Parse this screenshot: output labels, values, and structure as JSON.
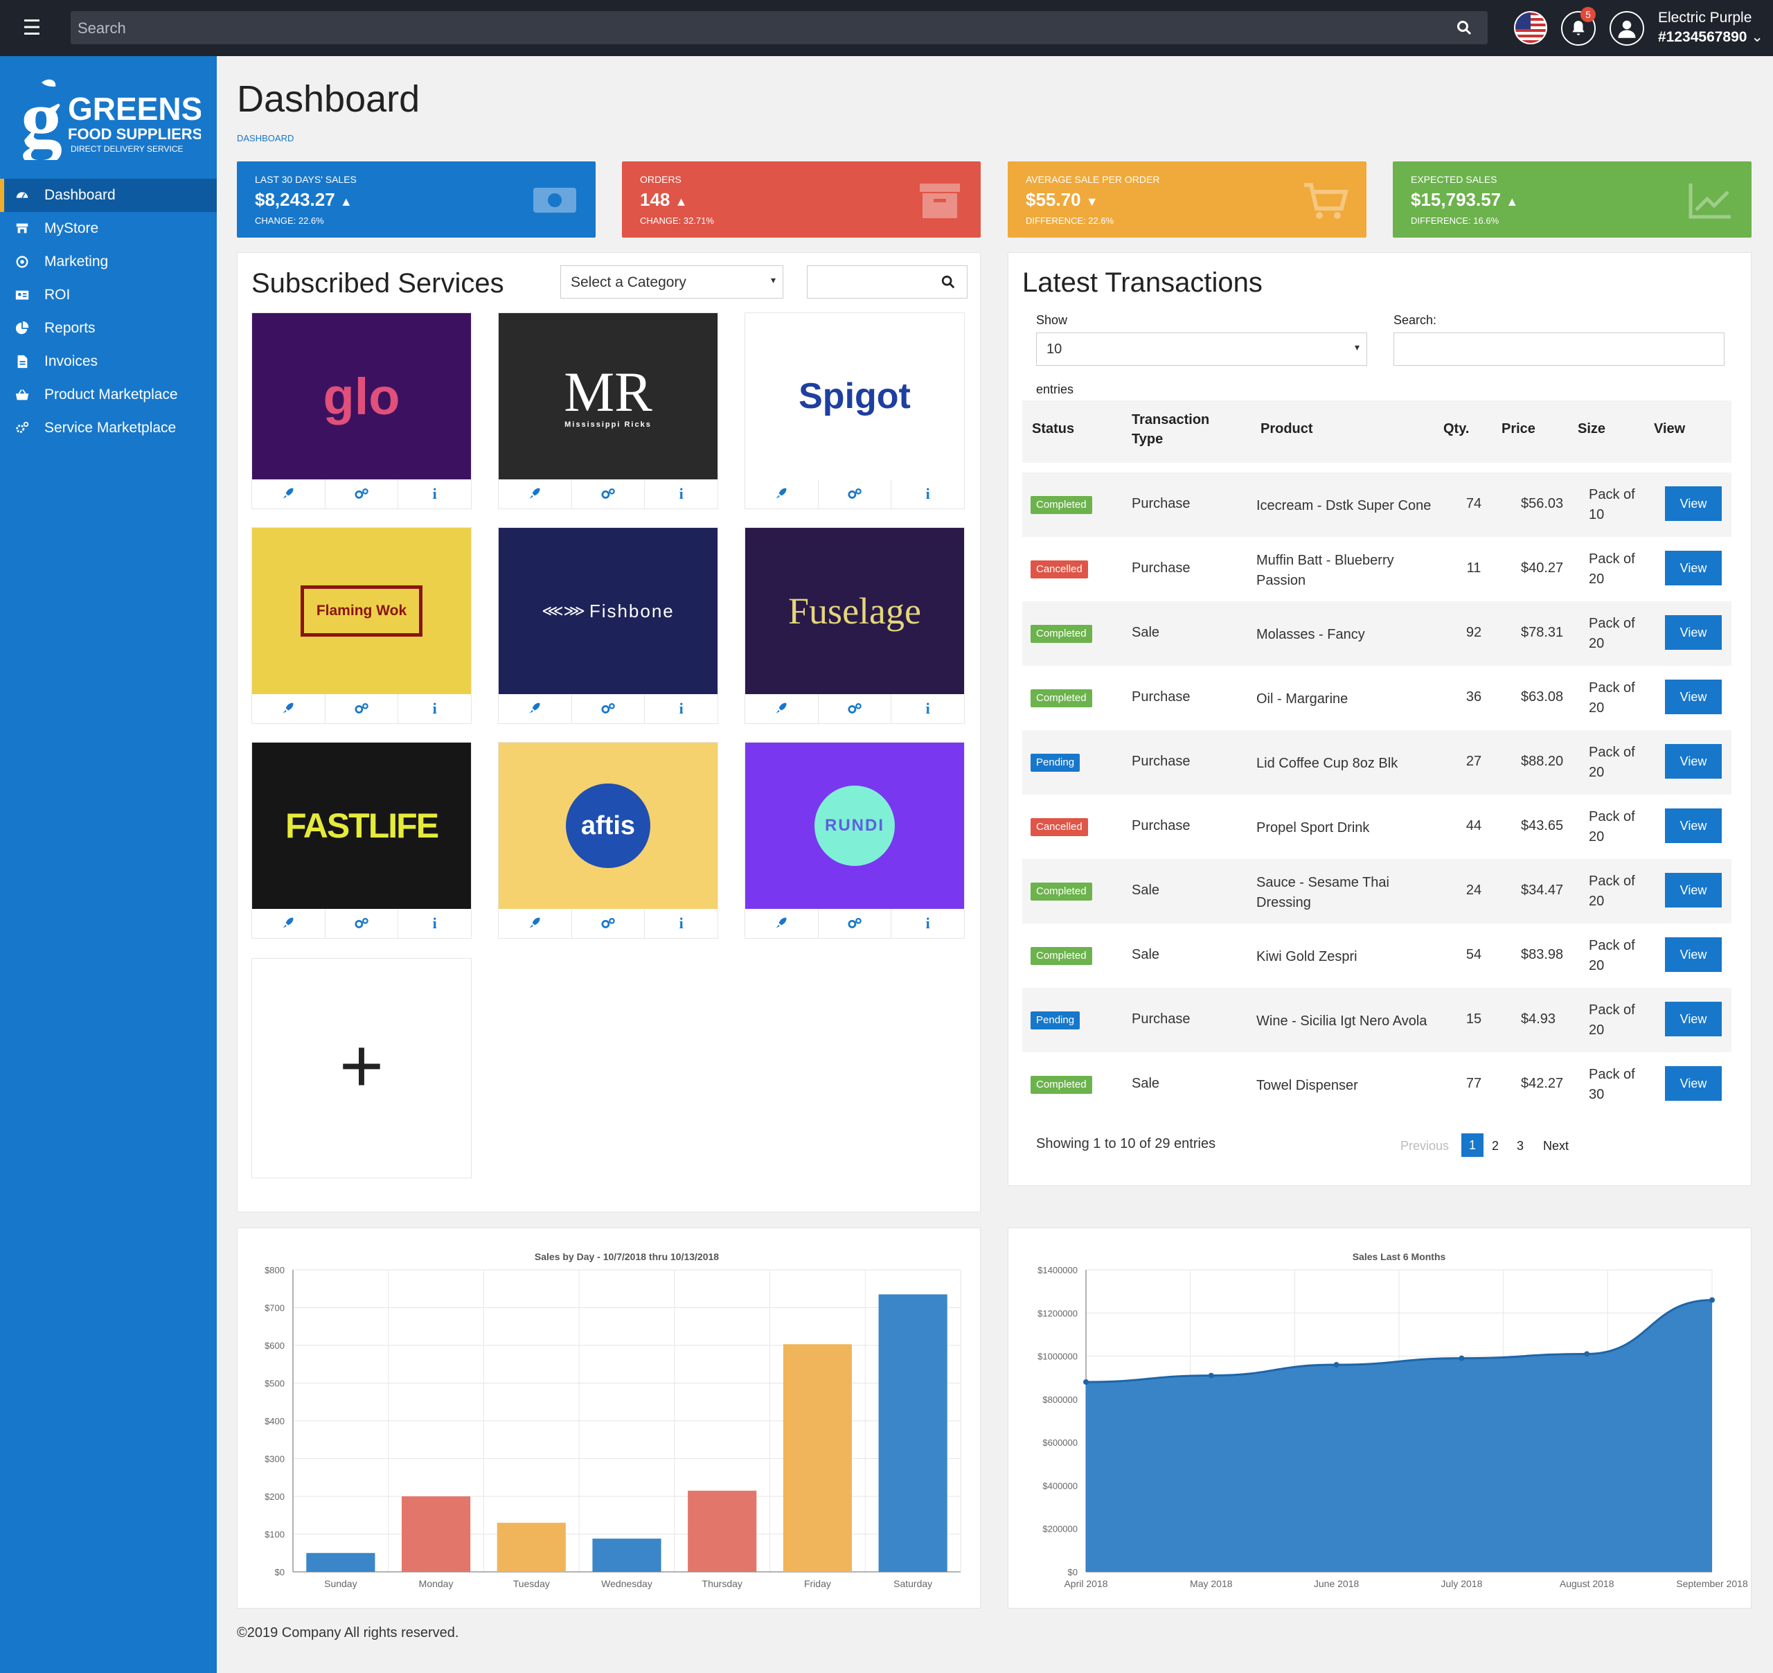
{
  "topbar": {
    "search_placeholder": "Search",
    "notification_count": "5",
    "user_name": "Electric Purple",
    "user_id": "#1234567890"
  },
  "sidebar": {
    "items": [
      {
        "label": "Dashboard",
        "icon": "gauge-icon"
      },
      {
        "label": "MyStore",
        "icon": "store-icon"
      },
      {
        "label": "Marketing",
        "icon": "bullseye-icon"
      },
      {
        "label": "ROI",
        "icon": "id-card-icon"
      },
      {
        "label": "Reports",
        "icon": "pie-chart-icon"
      },
      {
        "label": "Invoices",
        "icon": "file-icon"
      },
      {
        "label": "Product Marketplace",
        "icon": "basket-icon"
      },
      {
        "label": "Service Marketplace",
        "icon": "cogs-icon"
      }
    ],
    "logo": {
      "big": "GREENS",
      "mid": "FOOD SUPPLIERS",
      "small": "DIRECT DELIVERY SERVICE"
    }
  },
  "page": {
    "title": "Dashboard",
    "breadcrumb": "DASHBOARD"
  },
  "stats": [
    {
      "label": "LAST 30 DAYS' SALES",
      "value": "$8,243.27",
      "trend": "▲",
      "sub": "CHANGE: 22.6%",
      "color": "#1777cb"
    },
    {
      "label": "ORDERS",
      "value": "148",
      "trend": "▲",
      "sub": "CHANGE: 32.71%",
      "color": "#df5547"
    },
    {
      "label": "AVERAGE SALE PER ORDER",
      "value": "$55.70",
      "trend": "▼",
      "sub": "DIFFERENCE: 22.6%",
      "color": "#f0a93b"
    },
    {
      "label": "EXPECTED SALES",
      "value": "$15,793.57",
      "trend": "▲",
      "sub": "DIFFERENCE: 16.6%",
      "color": "#6cb24d"
    }
  ],
  "services": {
    "title": "Subscribed Services",
    "category_placeholder": "Select a Category",
    "tiles": [
      {
        "name": "glo",
        "bg": "#3c1260",
        "fg": "#e0507a"
      },
      {
        "name": "MR",
        "sub": "Mississippi Ricks",
        "bg": "#2a2a2a",
        "fg": "#ffffff"
      },
      {
        "name": "Spigot",
        "bg": "#ffffff",
        "fg": "#1e3fa0"
      },
      {
        "name": "Flaming Wok",
        "bg": "#ecd04a",
        "fg": "#8a1412"
      },
      {
        "name": "Fishbone",
        "bg": "#1d2359",
        "fg": "#ffffff"
      },
      {
        "name": "Fuselage",
        "bg": "#2a1a4a",
        "fg": "#e3d77a"
      },
      {
        "name": "FASTLIFE",
        "bg": "#161616",
        "fg": "#e6ea3a"
      },
      {
        "name": "aftis",
        "bg": "#f5d26e",
        "fg": "#ffffff"
      },
      {
        "name": "RUNDI",
        "bg": "#7a37f0",
        "fg": "#5e5ee0"
      }
    ],
    "add_label": "+"
  },
  "transactions": {
    "title": "Latest Transactions",
    "show_label": "Show",
    "show_value": "10",
    "entries_label": "entries",
    "search_label": "Search:",
    "headers": {
      "status": "Status",
      "type1": "Transaction",
      "type2": "Type",
      "product": "Product",
      "qty": "Qty.",
      "price": "Price",
      "size": "Size",
      "view": "View"
    },
    "rows": [
      {
        "status": "Completed",
        "type": "Purchase",
        "product1": "Icecream - Dstk Super Cone",
        "product2": "",
        "qty": "74",
        "price": "$56.03",
        "size1": "Pack of",
        "size2": "10"
      },
      {
        "status": "Cancelled",
        "type": "Purchase",
        "product1": "Muffin Batt - Blueberry",
        "product2": "Passion",
        "qty": "11",
        "price": "$40.27",
        "size1": "Pack of",
        "size2": "20"
      },
      {
        "status": "Completed",
        "type": "Sale",
        "product1": "Molasses - Fancy",
        "product2": "",
        "qty": "92",
        "price": "$78.31",
        "size1": "Pack of",
        "size2": "20"
      },
      {
        "status": "Completed",
        "type": "Purchase",
        "product1": "Oil - Margarine",
        "product2": "",
        "qty": "36",
        "price": "$63.08",
        "size1": "Pack of",
        "size2": "20"
      },
      {
        "status": "Pending",
        "type": "Purchase",
        "product1": "Lid Coffee Cup 8oz Blk",
        "product2": "",
        "qty": "27",
        "price": "$88.20",
        "size1": "Pack of",
        "size2": "20"
      },
      {
        "status": "Cancelled",
        "type": "Purchase",
        "product1": "Propel Sport Drink",
        "product2": "",
        "qty": "44",
        "price": "$43.65",
        "size1": "Pack of",
        "size2": "20"
      },
      {
        "status": "Completed",
        "type": "Sale",
        "product1": "Sauce - Sesame Thai",
        "product2": "Dressing",
        "qty": "24",
        "price": "$34.47",
        "size1": "Pack of",
        "size2": "20"
      },
      {
        "status": "Completed",
        "type": "Sale",
        "product1": "Kiwi Gold Zespri",
        "product2": "",
        "qty": "54",
        "price": "$83.98",
        "size1": "Pack of",
        "size2": "20"
      },
      {
        "status": "Pending",
        "type": "Purchase",
        "product1": "Wine - Sicilia Igt Nero Avola",
        "product2": "",
        "qty": "15",
        "price": "$4.93",
        "size1": "Pack of",
        "size2": "20"
      },
      {
        "status": "Completed",
        "type": "Sale",
        "product1": "Towel Dispenser",
        "product2": "",
        "qty": "77",
        "price": "$42.27",
        "size1": "Pack of",
        "size2": "30"
      }
    ],
    "view_label": "View",
    "status_colors": {
      "Completed": "#6cb24d",
      "Cancelled": "#df5547",
      "Pending": "#1777cb"
    },
    "footer": "Showing 1 to 10 of 29 entries",
    "pagination": {
      "previous": "Previous",
      "pages": [
        "1",
        "2",
        "3"
      ],
      "next": "Next"
    }
  },
  "chart_data": [
    {
      "type": "bar",
      "title": "Sales by Day - 10/7/2018 thru 10/13/2018",
      "categories": [
        "Sunday",
        "Monday",
        "Tuesday",
        "Wednesday",
        "Thursday",
        "Friday",
        "Saturday"
      ],
      "values": [
        50,
        200,
        130,
        88,
        215,
        603,
        735
      ],
      "colors": [
        "#3a86c8",
        "#e2766a",
        "#f0b55a",
        "#3a86c8",
        "#e2766a",
        "#f0b55a",
        "#3a86c8"
      ],
      "yticks": [
        "$0",
        "$100",
        "$200",
        "$300",
        "$400",
        "$500",
        "$600",
        "$700",
        "$800"
      ],
      "ylim": [
        0,
        800
      ],
      "grid": true
    },
    {
      "type": "area",
      "title": "Sales Last 6 Months",
      "categories": [
        "April 2018",
        "May 2018",
        "June 2018",
        "July 2018",
        "August 2018",
        "September 2018"
      ],
      "values": [
        880000,
        910000,
        960000,
        990000,
        1010000,
        1260000
      ],
      "color": "#2e7dc4",
      "yticks": [
        "$0",
        "$200000",
        "$400000",
        "$600000",
        "$800000",
        "$1000000",
        "$1200000",
        "$1400000"
      ],
      "ylim": [
        0,
        1400000
      ],
      "grid": true
    }
  ],
  "footer": "©2019 Company All rights reserved."
}
